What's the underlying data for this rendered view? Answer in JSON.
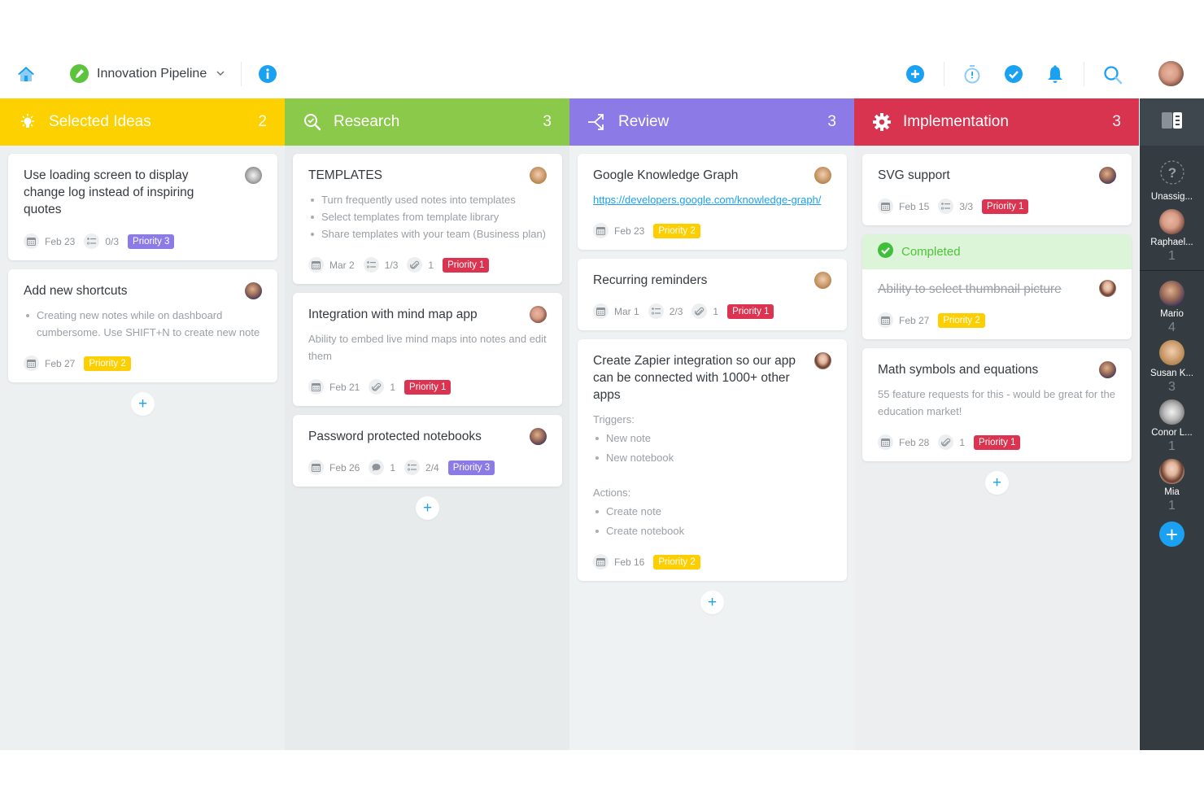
{
  "topbar": {
    "board_name": "Innovation Pipeline",
    "icons": [
      "home-icon",
      "board-icon",
      "chevron-down-icon",
      "info-icon",
      "add-icon",
      "timer-icon",
      "check-icon",
      "bell-icon",
      "search-icon",
      "user-avatar"
    ]
  },
  "colors": {
    "selected_ideas": "#fdd000",
    "research": "#8bc94a",
    "review": "#8c7be6",
    "implementation": "#d8344f",
    "accent": "#1ba1f2",
    "priority_1": "#dc3450",
    "priority_2": "#fdcf00",
    "priority_3": "#8c7be6"
  },
  "columns": [
    {
      "title": "Selected Ideas",
      "count": "2",
      "icon": "lightbulb-icon",
      "cards": [
        {
          "title": "Use loading screen to display change log instead of inspiring quotes",
          "date": "Feb 23",
          "checklist": "0/3",
          "priority": "Priority 3"
        },
        {
          "title": "Add new shortcuts",
          "bullets": [
            "Creating new notes while on dashboard cumbersome. Use SHIFT+N to create new note"
          ],
          "date": "Feb 27",
          "priority": "Priority 2"
        }
      ]
    },
    {
      "title": "Research",
      "count": "3",
      "icon": "search-check-icon",
      "cards": [
        {
          "title": "TEMPLATES",
          "bullets": [
            "Turn frequently used notes into templates",
            "Select templates from template library",
            "Share templates with your team (Business plan)"
          ],
          "date": "Mar 2",
          "checklist": "1/3",
          "attachments": "1",
          "priority": "Priority 1"
        },
        {
          "title": "Integration with mind map app",
          "description": "Ability to embed live mind maps into notes and edit them",
          "date": "Feb 21",
          "attachments": "1",
          "priority": "Priority 1"
        },
        {
          "title": "Password protected notebooks",
          "date": "Feb 26",
          "comments": "1",
          "checklist": "2/4",
          "priority": "Priority 3"
        }
      ]
    },
    {
      "title": "Review",
      "count": "3",
      "icon": "merge-arrows-icon",
      "cards": [
        {
          "title": "Google Knowledge Graph",
          "link": "https://developers.google.com/knowledge-graph/",
          "date": "Feb 23",
          "priority": "Priority 2"
        },
        {
          "title": "Recurring reminders",
          "date": "Mar 1",
          "checklist": "2/3",
          "attachments": "1",
          "priority": "Priority 1"
        },
        {
          "title": "Create Zapier integration so our app can be connected with 1000+ other apps",
          "triggers_label": "Triggers:",
          "triggers": [
            "New note",
            "New notebook"
          ],
          "actions_label": "Actions:",
          "actions": [
            "Create note",
            "Create notebook"
          ],
          "date": "Feb 16",
          "priority": "Priority 2"
        }
      ]
    },
    {
      "title": "Implementation",
      "count": "3",
      "icon": "gear-icon",
      "cards": [
        {
          "title": "SVG support",
          "date": "Feb 15",
          "checklist": "3/3",
          "priority": "Priority 1"
        },
        {
          "status": "Completed",
          "title": "Ability to select thumbnail picture",
          "date": "Feb 27",
          "priority": "Priority 2"
        },
        {
          "title": "Math symbols and equations",
          "description": "55 feature requests for this - would be great for the education market!",
          "date": "Feb 28",
          "attachments": "1",
          "priority": "Priority 1"
        }
      ]
    }
  ],
  "sidebar": {
    "members": [
      {
        "name": "Unassig...",
        "count": ""
      },
      {
        "name": "Raphael...",
        "count": "1"
      },
      {
        "name": "Mario",
        "count": "4"
      },
      {
        "name": "Susan K...",
        "count": "3"
      },
      {
        "name": "Conor L...",
        "count": "1"
      },
      {
        "name": "Mia",
        "count": "1"
      }
    ]
  }
}
